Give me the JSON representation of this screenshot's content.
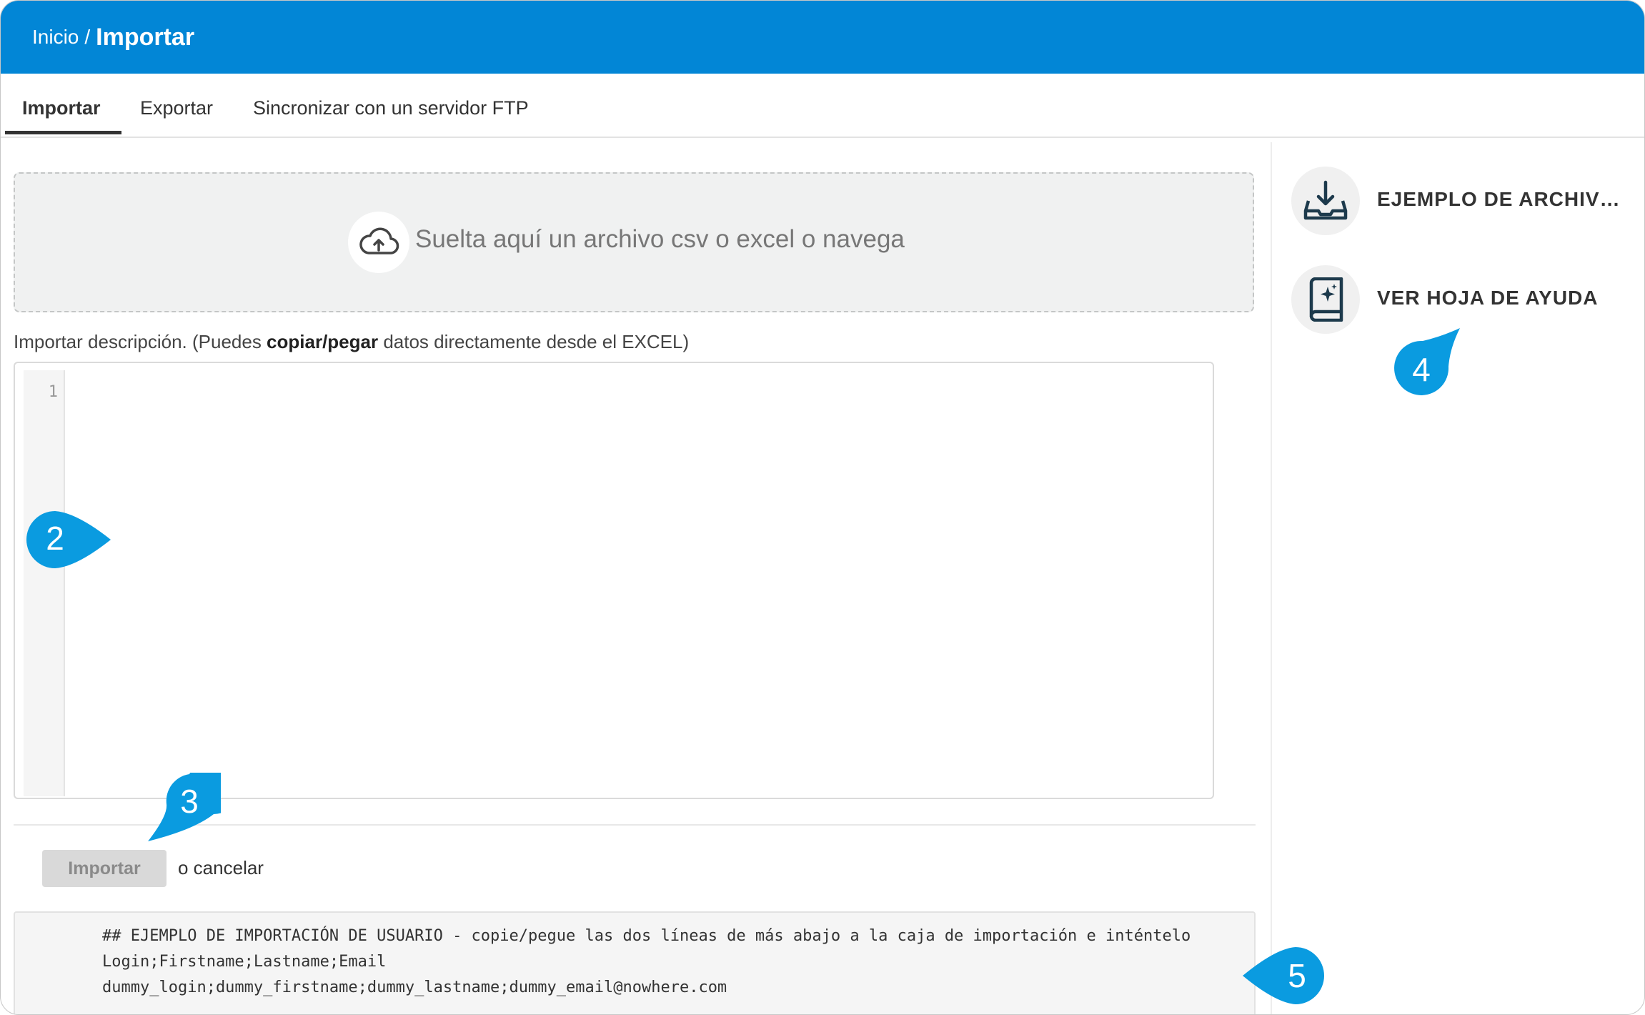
{
  "colors": {
    "header": "#0286d6",
    "marker": "#0a9be0"
  },
  "breadcrumb": {
    "home": "Inicio",
    "separator": "/",
    "current": "Importar"
  },
  "tabs": [
    {
      "label": "Importar",
      "active": true
    },
    {
      "label": "Exportar",
      "active": false
    },
    {
      "label": "Sincronizar con un servidor FTP",
      "active": false
    }
  ],
  "dropzone": {
    "icon": "cloud-upload-icon",
    "text": "Suelta aquí un archivo csv o excel o navega"
  },
  "description": {
    "prefix": "Importar descripción. (Puedes ",
    "bold": "copiar/pegar",
    "suffix": " datos directamente desde el EXCEL)"
  },
  "editor": {
    "line_numbers": [
      "1"
    ],
    "value": ""
  },
  "actions": {
    "import_label": "Importar",
    "cancel_label": "o cancelar"
  },
  "example": {
    "lines": [
      "## EJEMPLO DE IMPORTACIÓN DE USUARIO - copie/pegue las dos líneas de más abajo a la caja de importación e inténtelo",
      "Login;Firstname;Lastname;Email",
      "dummy_login;dummy_firstname;dummy_lastname;dummy_email@nowhere.com"
    ]
  },
  "sidebar": {
    "items": [
      {
        "label": "EJEMPLO DE ARCHIVO E...",
        "icon": "download-tray-icon"
      },
      {
        "label": "VER HOJA DE AYUDA",
        "icon": "help-book-icon"
      }
    ]
  },
  "markers": [
    "2",
    "3",
    "4",
    "5"
  ]
}
